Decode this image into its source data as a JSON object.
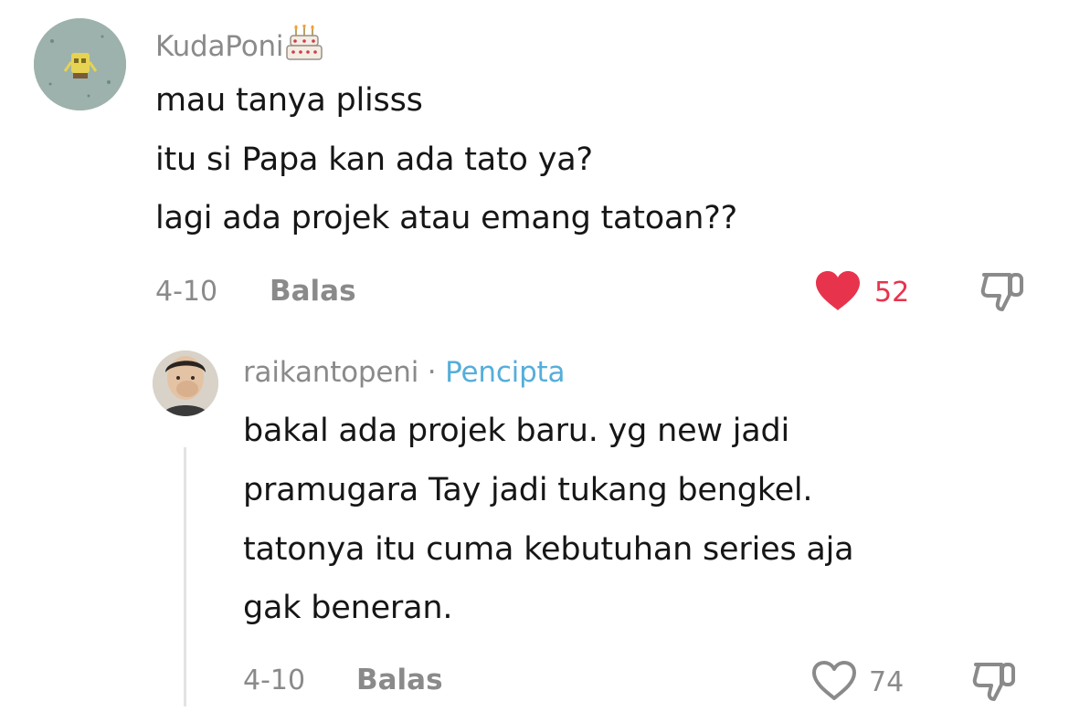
{
  "comment": {
    "username": "KudaPoni",
    "badge_icon": "birthday-cake-icon",
    "lines": [
      "mau tanya plisss",
      "itu si Papa kan ada tato ya?",
      "lagi ada projek atau emang tatoan??"
    ],
    "date": "4-10",
    "reply_label": "Balas",
    "like_count": "52",
    "liked": true,
    "like_color": "#e8334d"
  },
  "reply": {
    "username": "raikantopeni",
    "separator": " · ",
    "creator_label": "Pencipta",
    "creator_color": "#55aed9",
    "lines": [
      "bakal ada projek baru. yg new jadi",
      "pramugara Tay jadi tukang bengkel.",
      "tatonya itu cuma kebutuhan series aja",
      "gak beneran."
    ],
    "date": "4-10",
    "reply_label": "Balas",
    "like_count": "74",
    "liked": false
  }
}
